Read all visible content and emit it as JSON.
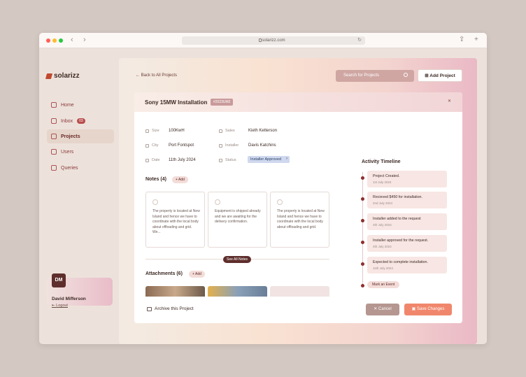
{
  "browser": {
    "url": "solarizz.com"
  },
  "brand": {
    "name": "solarizz",
    "accent": "#c0492f"
  },
  "sidebar": {
    "items": [
      {
        "label": "Home",
        "icon": "home-icon"
      },
      {
        "label": "Inbox",
        "icon": "inbox-icon",
        "badge": "03"
      },
      {
        "label": "Projects",
        "icon": "folder-icon",
        "active": true
      },
      {
        "label": "Users",
        "icon": "users-icon"
      },
      {
        "label": "Queries",
        "icon": "chat-icon"
      }
    ],
    "user": {
      "initials": "DM",
      "name": "David Mifferson",
      "logout": "Logout"
    }
  },
  "header": {
    "back": "Back to All Projects",
    "search_placeholder": "Search for Projects",
    "add_project": "Add Project"
  },
  "project": {
    "title": "Sony 15MW Installation",
    "id": "#2023UM2",
    "fields": {
      "size_label": "Size",
      "size": "100KwH",
      "city_label": "City",
      "city": "Port Fontspot",
      "date_label": "Date",
      "date": "11th July 2024",
      "sales_label": "Sales",
      "sales": "Kieth Ketterson",
      "installer_label": "Installer",
      "installer": "Davis Katchins",
      "status_label": "Status",
      "status": "Installer Approved"
    }
  },
  "notes": {
    "title": "Notes (4)",
    "add": "+ Add",
    "items": [
      "The property is located at New Island and hence we have to coordinate with the local body about offloading and grid. We...",
      "Equipment is shipped already and we are awaiting for the delivery confirmation.",
      "The property is located at New Island and hence we have to coordinate with the local body about offloading and grid."
    ],
    "see_all": "See All Notes"
  },
  "attachments": {
    "title": "Attachments (6)",
    "add": "+ Add"
  },
  "timeline": {
    "title": "Activity Timeline",
    "events": [
      {
        "text": "Project Created.",
        "date": "1st July 2024"
      },
      {
        "text": "Recieved $450 for installation.",
        "date": "2nd July 2024"
      },
      {
        "text": "Installer added to the request",
        "date": "4th July 2024"
      },
      {
        "text": "Installer approved for the request.",
        "date": "4th July 2024"
      },
      {
        "text": "Expected to complete installation.",
        "date": "11th July 2024"
      }
    ],
    "mark_event": "Mark an Event"
  },
  "footer": {
    "archive": "Archive this Project",
    "cancel": "Cancel",
    "save": "Save Changes"
  }
}
